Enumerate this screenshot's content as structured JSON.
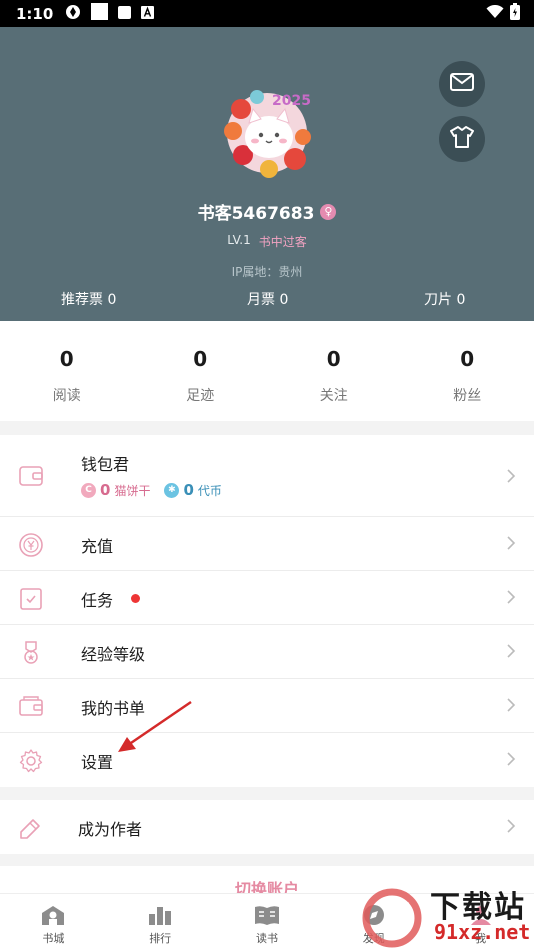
{
  "status_bar": {
    "time": "1:10"
  },
  "profile": {
    "username": "书客5467683",
    "gender_symbol": "♀",
    "level": "LV.1",
    "level_name": "书中过客",
    "ip_location": "IP属地：贵州",
    "avatar_badge": "2025",
    "tickets": [
      {
        "label": "推荐票 0"
      },
      {
        "label": "月票 0"
      },
      {
        "label": "刀片 0"
      }
    ]
  },
  "stats": [
    {
      "value": "0",
      "label": "阅读"
    },
    {
      "value": "0",
      "label": "足迹"
    },
    {
      "value": "0",
      "label": "关注"
    },
    {
      "value": "0",
      "label": "粉丝"
    }
  ],
  "wallet": {
    "label": "钱包君",
    "catcookie_value": "0",
    "catcookie_label": "猫饼干",
    "token_value": "0",
    "token_label": "代币"
  },
  "menu": [
    {
      "label": "充值",
      "icon": "recharge-icon"
    },
    {
      "label": "任务",
      "icon": "task-icon",
      "has_dot": true
    },
    {
      "label": "经验等级",
      "icon": "level-medal-icon"
    },
    {
      "label": "我的书单",
      "icon": "booklist-icon"
    },
    {
      "label": "设置",
      "icon": "gear-icon"
    }
  ],
  "author": {
    "label": "成为作者"
  },
  "switch_account": {
    "label": "切换账户"
  },
  "tabbar": [
    {
      "label": "书城",
      "icon": "bookstore-icon"
    },
    {
      "label": "排行",
      "icon": "ranking-icon"
    },
    {
      "label": "读书",
      "icon": "reading-icon"
    },
    {
      "label": "发现",
      "icon": "discover-icon"
    },
    {
      "label": "我",
      "icon": "me-icon"
    }
  ],
  "watermark": {
    "title": "下载站",
    "url": "91xz.net"
  },
  "colors": {
    "header_bg": "#586e76",
    "accent_pink": "#e58aa2",
    "token_blue": "#3a8fb7",
    "annotation_red": "#d42a2a"
  }
}
